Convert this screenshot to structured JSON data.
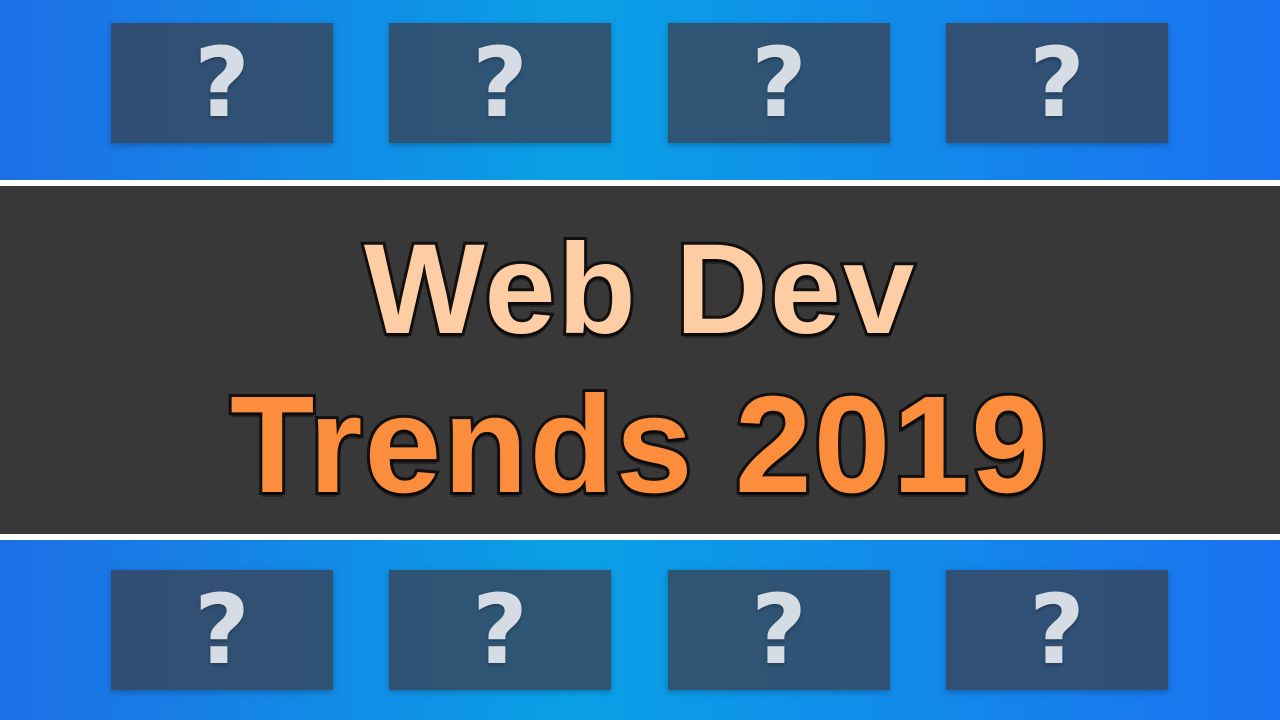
{
  "title": {
    "line1": "Web Dev",
    "line2": "Trends 2019"
  },
  "tiles": {
    "top": [
      "?",
      "?",
      "?",
      "?"
    ],
    "bottom": [
      "?",
      "?",
      "?",
      "?"
    ]
  },
  "colors": {
    "background_blue": "#1d6fe6",
    "tile": "#37465a",
    "banner": "#383838",
    "title_line1": "#ffcda3",
    "title_line2": "#fb8d3c",
    "question_mark": "#d6dce4"
  }
}
